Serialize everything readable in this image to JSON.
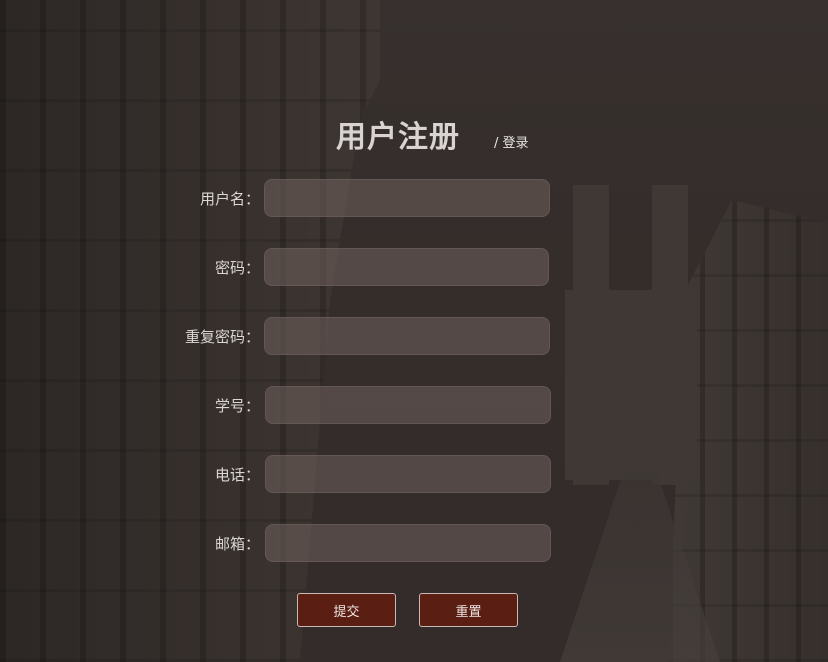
{
  "page": {
    "title": "用户注册",
    "login_link": "/ 登录"
  },
  "form": {
    "fields": [
      {
        "label": "用户名：",
        "value": ""
      },
      {
        "label": "密码：",
        "value": ""
      },
      {
        "label": "重复密码：",
        "value": ""
      },
      {
        "label": "学号：",
        "value": ""
      },
      {
        "label": "电话：",
        "value": ""
      },
      {
        "label": "邮箱：",
        "value": ""
      }
    ],
    "submit_label": "提交",
    "reset_label": "重置"
  },
  "colors": {
    "button_bg": "#5a1e12",
    "input_bg": "#70605c",
    "title_text": "#d9d4d2"
  }
}
